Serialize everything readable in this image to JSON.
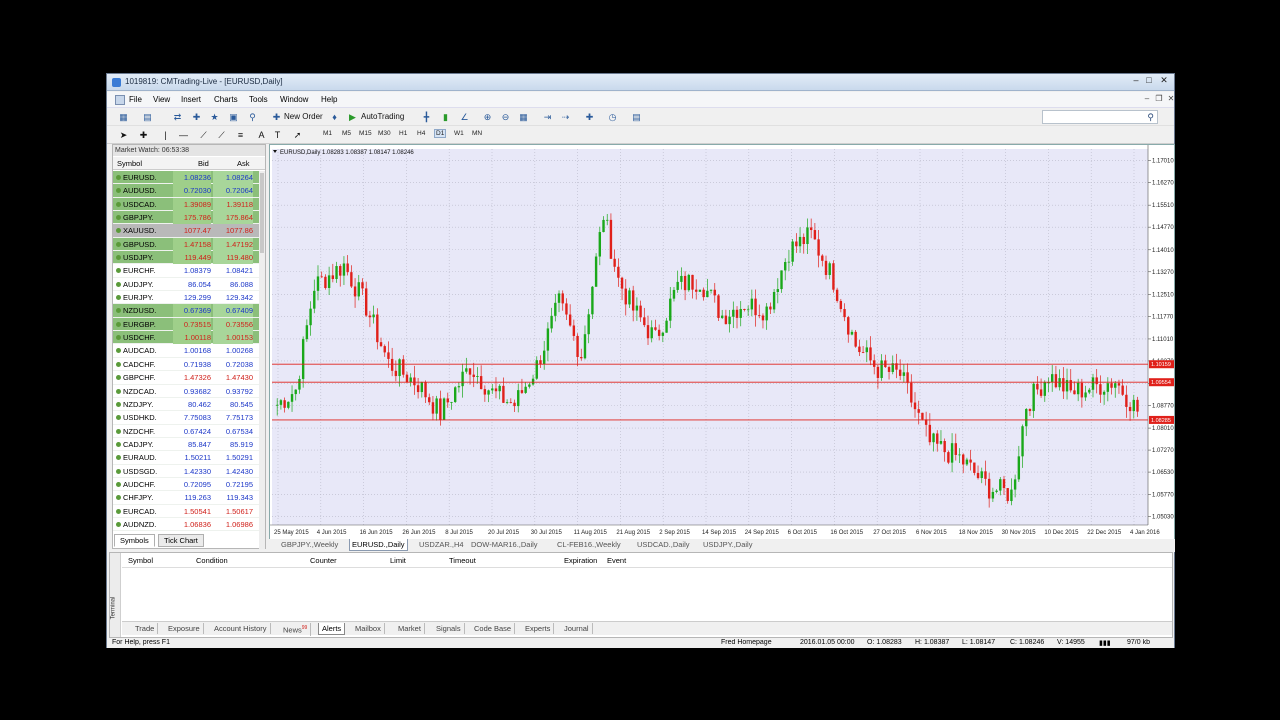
{
  "window": {
    "title": "1019819: CMTrading-Live - [EURUSD,Daily]"
  },
  "menu": [
    "File",
    "View",
    "Insert",
    "Charts",
    "Tools",
    "Window",
    "Help"
  ],
  "toolbar": {
    "new_order": "New Order",
    "autotrading": "AutoTrading"
  },
  "timeframes": [
    "M1",
    "M5",
    "M15",
    "M30",
    "H1",
    "H4",
    "D1",
    "W1",
    "MN"
  ],
  "active_timeframe": "D1",
  "market_watch": {
    "header": "Market Watch: 06:53:38",
    "col_symbol": "Symbol",
    "col_bid": "Bid",
    "col_ask": "Ask",
    "rows": [
      {
        "symbol": "EURUSD.",
        "bid": "1.08236",
        "ask": "1.08264",
        "color": "blue",
        "hl": true
      },
      {
        "symbol": "AUDUSD.",
        "bid": "0.72030",
        "ask": "0.72064",
        "color": "blue",
        "hl": true
      },
      {
        "symbol": "USDCAD.",
        "bid": "1.39089",
        "ask": "1.39118",
        "color": "red",
        "hl": true
      },
      {
        "symbol": "GBPJPY.",
        "bid": "175.786",
        "ask": "175.864",
        "color": "red",
        "hl": true
      },
      {
        "symbol": "XAUUSD.",
        "bid": "1077.47",
        "ask": "1077.86",
        "color": "red",
        "sel": true
      },
      {
        "symbol": "GBPUSD.",
        "bid": "1.47158",
        "ask": "1.47192",
        "color": "red",
        "hl": true
      },
      {
        "symbol": "USDJPY.",
        "bid": "119.449",
        "ask": "119.480",
        "color": "red",
        "hl": true
      },
      {
        "symbol": "EURCHF.",
        "bid": "1.08379",
        "ask": "1.08421",
        "color": "blue"
      },
      {
        "symbol": "AUDJPY.",
        "bid": "86.054",
        "ask": "86.088",
        "color": "blue"
      },
      {
        "symbol": "EURJPY.",
        "bid": "129.299",
        "ask": "129.342",
        "color": "blue"
      },
      {
        "symbol": "NZDUSD.",
        "bid": "0.67369",
        "ask": "0.67409",
        "color": "blue",
        "hl": true
      },
      {
        "symbol": "EURGBP.",
        "bid": "0.73515",
        "ask": "0.73556",
        "color": "red",
        "hl": true
      },
      {
        "symbol": "USDCHF.",
        "bid": "1.00118",
        "ask": "1.00153",
        "color": "red",
        "hl": true
      },
      {
        "symbol": "AUDCAD.",
        "bid": "1.00168",
        "ask": "1.00268",
        "color": "blue"
      },
      {
        "symbol": "CADCHF.",
        "bid": "0.71938",
        "ask": "0.72038",
        "color": "blue"
      },
      {
        "symbol": "GBPCHF.",
        "bid": "1.47326",
        "ask": "1.47430",
        "color": "red"
      },
      {
        "symbol": "NZDCAD.",
        "bid": "0.93682",
        "ask": "0.93792",
        "color": "blue"
      },
      {
        "symbol": "NZDJPY.",
        "bid": "80.462",
        "ask": "80.545",
        "color": "blue"
      },
      {
        "symbol": "USDHKD.",
        "bid": "7.75083",
        "ask": "7.75173",
        "color": "blue"
      },
      {
        "symbol": "NZDCHF.",
        "bid": "0.67424",
        "ask": "0.67534",
        "color": "blue"
      },
      {
        "symbol": "CADJPY.",
        "bid": "85.847",
        "ask": "85.919",
        "color": "blue"
      },
      {
        "symbol": "EURAUD.",
        "bid": "1.50211",
        "ask": "1.50291",
        "color": "blue"
      },
      {
        "symbol": "USDSGD.",
        "bid": "1.42330",
        "ask": "1.42430",
        "color": "blue"
      },
      {
        "symbol": "AUDCHF.",
        "bid": "0.72095",
        "ask": "0.72195",
        "color": "blue"
      },
      {
        "symbol": "CHFJPY.",
        "bid": "119.263",
        "ask": "119.343",
        "color": "blue"
      },
      {
        "symbol": "EURCAD.",
        "bid": "1.50541",
        "ask": "1.50617",
        "color": "red"
      },
      {
        "symbol": "AUDNZD.",
        "bid": "1.06836",
        "ask": "1.06986",
        "color": "red"
      }
    ],
    "tabs": [
      "Symbols",
      "Tick Chart"
    ]
  },
  "chart": {
    "info": "EURUSD,Daily  1.08283 1.08387 1.08147 1.08246",
    "price_labels": [
      "1.17010",
      "1.16270",
      "1.15510",
      "1.14770",
      "1.14010",
      "1.13270",
      "1.12510",
      "1.11770",
      "1.11010",
      "1.10270",
      "1.09510",
      "1.08770",
      "1.08010",
      "1.07270",
      "1.06530",
      "1.05770",
      "1.05030"
    ],
    "hlines": [
      {
        "price": 1.10159,
        "label": "1.10159"
      },
      {
        "price": 1.09554,
        "label": "1.09554"
      },
      {
        "price": 1.08285,
        "label": "1.08285"
      }
    ],
    "date_labels": [
      "25 May 2015",
      "4 Jun 2015",
      "16 Jun 2015",
      "26 Jun 2015",
      "8 Jul 2015",
      "20 Jul 2015",
      "30 Jul 2015",
      "11 Aug 2015",
      "21 Aug 2015",
      "2 Sep 2015",
      "14 Sep 2015",
      "24 Sep 2015",
      "6 Oct 2015",
      "16 Oct 2015",
      "27 Oct 2015",
      "6 Nov 2015",
      "18 Nov 2015",
      "30 Nov 2015",
      "10 Dec 2015",
      "22 Dec 2015",
      "4 Jan 2016"
    ]
  },
  "chart_tabs": [
    "GBPJPY.,Weekly",
    "EURUSD.,Daily",
    "USDZAR.,H4",
    "DOW-MAR16.,Daily",
    "CL-FEB16.,Weekly",
    "USDCAD.,Daily",
    "USDJPY.,Daily"
  ],
  "active_chart_tab": "EURUSD.,Daily",
  "terminal": {
    "side_label": "Terminal",
    "columns": [
      "Symbol",
      "Condition",
      "Counter",
      "Limit",
      "Timeout",
      "Expiration",
      "Event"
    ],
    "tabs": [
      "Trade",
      "Exposure",
      "Account History",
      "News",
      "Alerts",
      "Mailbox",
      "Market",
      "Signals",
      "Code Base",
      "Experts",
      "Journal"
    ],
    "news_badge": "99",
    "active_tab": "Alerts"
  },
  "status": {
    "help": "For Help, press F1",
    "profile": "Fred Homepage",
    "time": "2016.01.05 00:00",
    "o": "O: 1.08283",
    "h": "H: 1.08387",
    "l": "L: 1.08147",
    "c": "C: 1.08246",
    "v": "V: 14955",
    "traffic": "97/0 kb"
  }
}
